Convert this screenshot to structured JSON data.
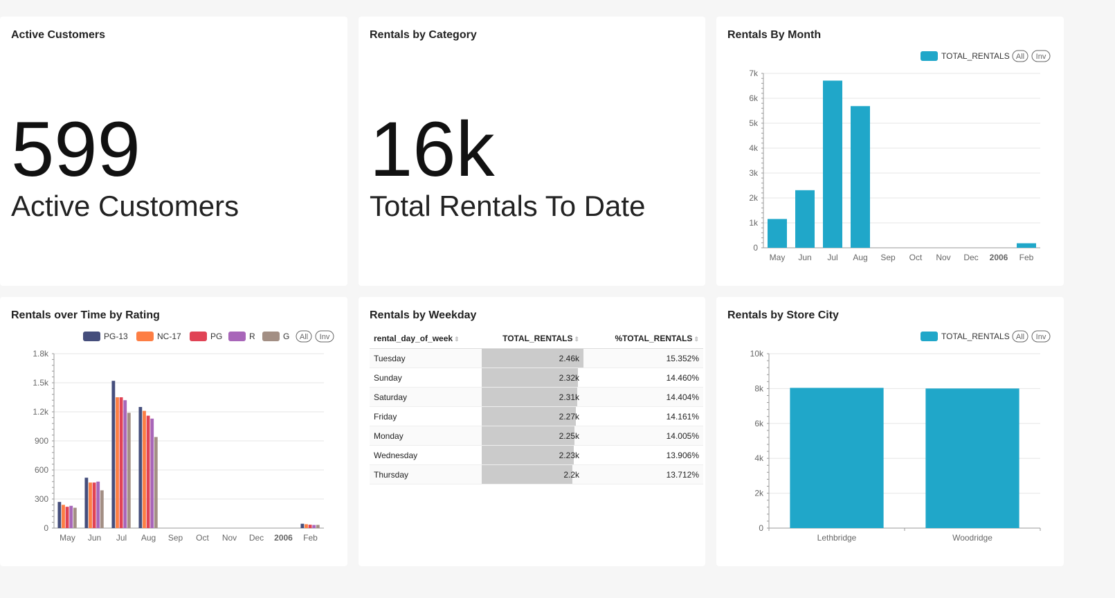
{
  "cards": {
    "active_customers": {
      "title": "Active Customers",
      "value": "599",
      "subtitle": "Active Customers"
    },
    "rentals_by_category": {
      "title": "Rentals by Category",
      "value": "16k",
      "subtitle": "Total Rentals To Date"
    },
    "rentals_by_month": {
      "title": "Rentals By Month"
    },
    "rentals_over_time": {
      "title": "Rentals over Time by Rating"
    },
    "rentals_by_weekday": {
      "title": "Rentals by Weekday"
    },
    "rentals_by_store": {
      "title": "Rentals by Store City"
    }
  },
  "legend_buttons": {
    "all": "All",
    "inv": "Inv"
  },
  "colors": {
    "teal": "#20a7c9",
    "pg13": "#454e7c",
    "nc17": "#fd7e44",
    "pg": "#e04355",
    "r": "#a866b9",
    "g": "#a38f84"
  },
  "weekday_table": {
    "headers": [
      "rental_day_of_week",
      "TOTAL_RENTALS",
      "%TOTAL_RENTALS"
    ],
    "rows": [
      {
        "day": "Tuesday",
        "total": "2.46k",
        "pct": "15.352%",
        "value": 2.46
      },
      {
        "day": "Sunday",
        "total": "2.32k",
        "pct": "14.460%",
        "value": 2.32
      },
      {
        "day": "Saturday",
        "total": "2.31k",
        "pct": "14.404%",
        "value": 2.31
      },
      {
        "day": "Friday",
        "total": "2.27k",
        "pct": "14.161%",
        "value": 2.27
      },
      {
        "day": "Monday",
        "total": "2.25k",
        "pct": "14.005%",
        "value": 2.25
      },
      {
        "day": "Wednesday",
        "total": "2.23k",
        "pct": "13.906%",
        "value": 2.23
      },
      {
        "day": "Thursday",
        "total": "2.2k",
        "pct": "13.712%",
        "value": 2.2
      }
    ]
  },
  "chart_data": [
    {
      "type": "bar",
      "title": "Rentals By Month",
      "categories": [
        "May",
        "Jun",
        "Jul",
        "Aug",
        "Sep",
        "Oct",
        "Nov",
        "Dec",
        "2006",
        "Feb"
      ],
      "series": [
        {
          "name": "TOTAL_RENTALS",
          "values": [
            1156,
            2311,
            6709,
            5686,
            0,
            0,
            0,
            0,
            0,
            182
          ]
        }
      ],
      "yticks": [
        "0",
        "1k",
        "2k",
        "3k",
        "4k",
        "5k",
        "6k",
        "7k"
      ],
      "ylim": [
        0,
        7000
      ],
      "grid": true,
      "legend": "top-right"
    },
    {
      "type": "bar",
      "title": "Rentals over Time by Rating",
      "categories": [
        "May",
        "Jun",
        "Jul",
        "Aug",
        "Sep",
        "Oct",
        "Nov",
        "Dec",
        "2006",
        "Feb"
      ],
      "series": [
        {
          "name": "PG-13",
          "values": [
            270,
            520,
            1520,
            1250,
            0,
            0,
            0,
            0,
            0,
            45
          ]
        },
        {
          "name": "NC-17",
          "values": [
            240,
            470,
            1350,
            1210,
            0,
            0,
            0,
            0,
            0,
            40
          ]
        },
        {
          "name": "PG",
          "values": [
            220,
            470,
            1350,
            1160,
            0,
            0,
            0,
            0,
            0,
            35
          ]
        },
        {
          "name": "R",
          "values": [
            230,
            480,
            1320,
            1130,
            0,
            0,
            0,
            0,
            0,
            32
          ]
        },
        {
          "name": "G",
          "values": [
            210,
            390,
            1190,
            940,
            0,
            0,
            0,
            0,
            0,
            33
          ]
        }
      ],
      "yticks": [
        "0",
        "300",
        "600",
        "900",
        "1.2k",
        "1.5k",
        "1.8k"
      ],
      "ylim": [
        0,
        1800
      ],
      "grid": true,
      "legend": "top-right"
    },
    {
      "type": "bar",
      "title": "Rentals by Store City",
      "categories": [
        "Lethbridge",
        "Woodridge"
      ],
      "series": [
        {
          "name": "TOTAL_RENTALS",
          "values": [
            8040,
            8004
          ]
        }
      ],
      "yticks": [
        "0",
        "2k",
        "4k",
        "6k",
        "8k",
        "10k"
      ],
      "ylim": [
        0,
        10000
      ],
      "grid": true,
      "legend": "top-right"
    }
  ]
}
